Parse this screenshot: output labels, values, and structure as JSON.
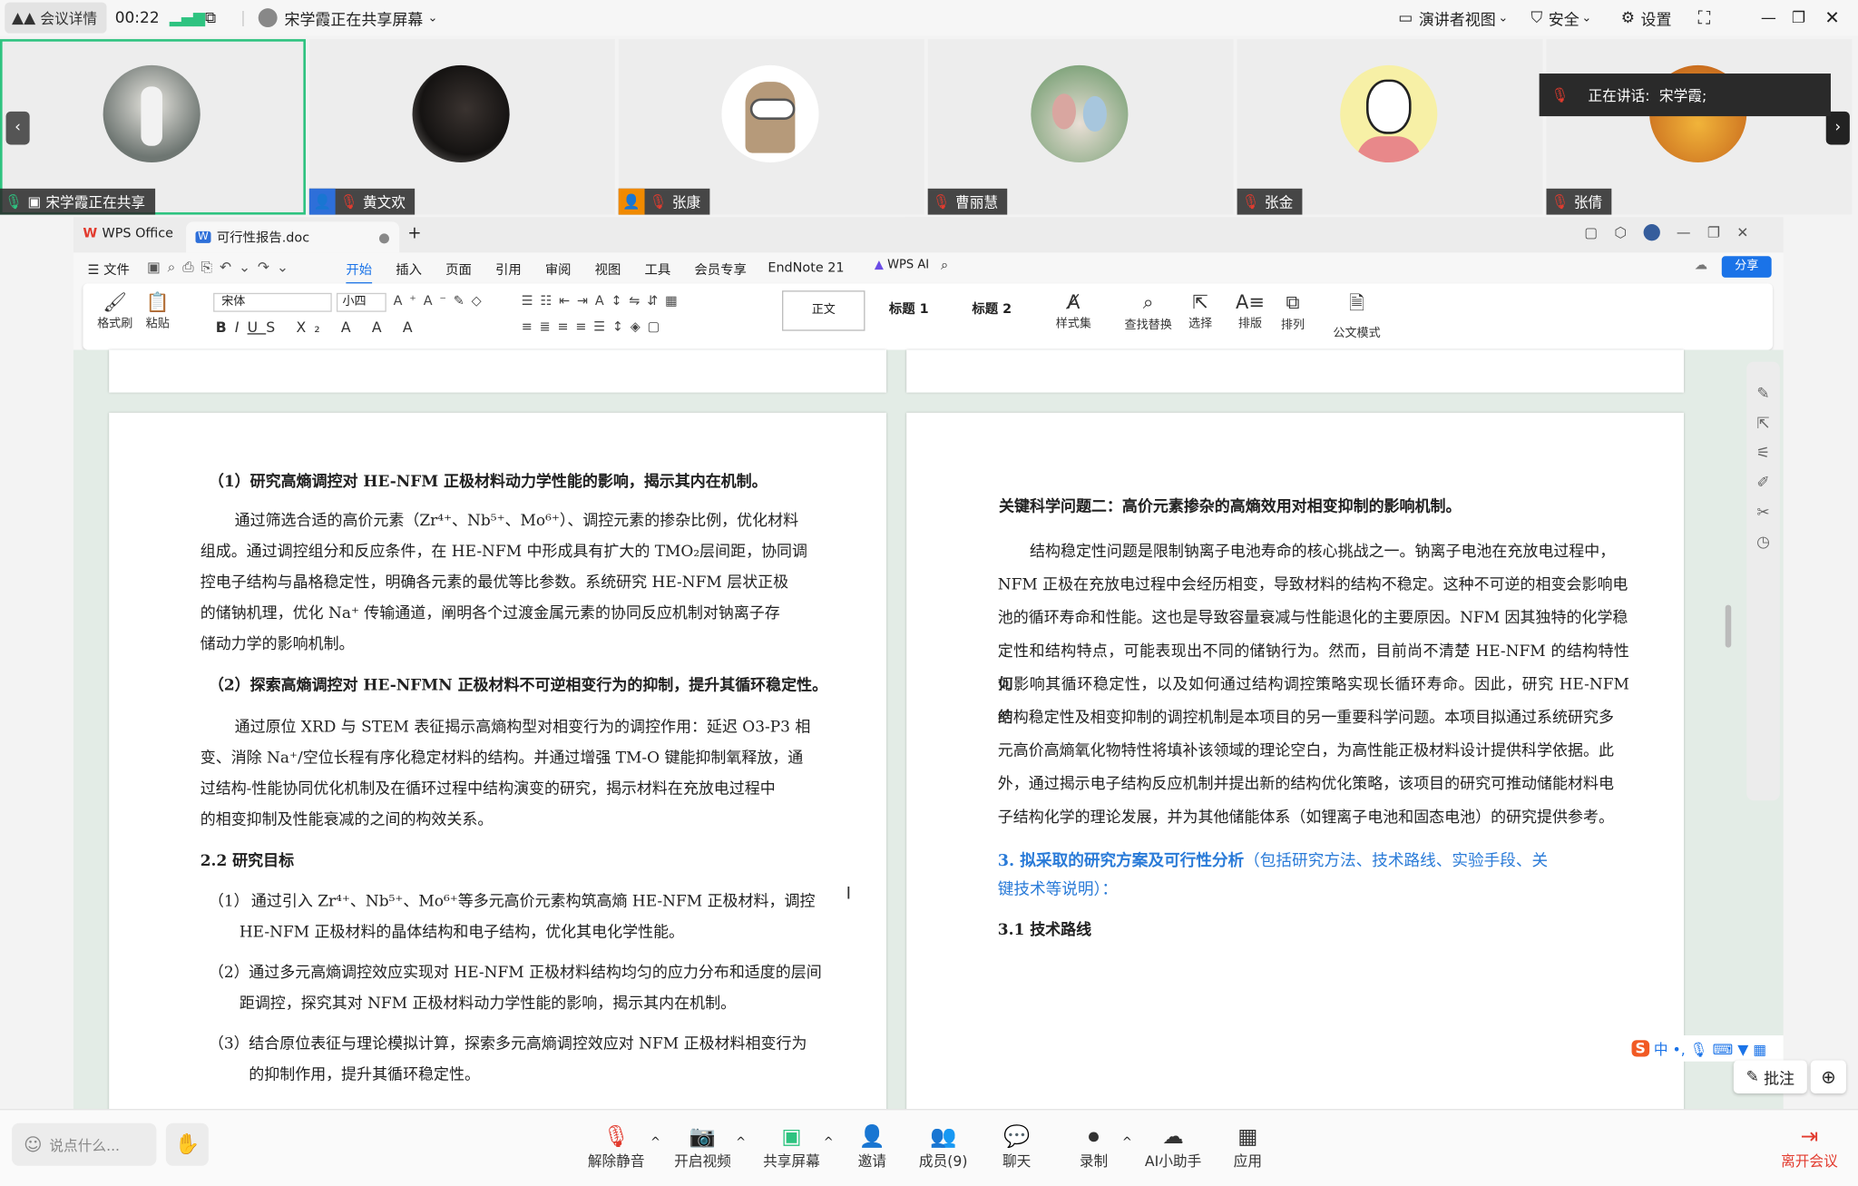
{
  "topbar": {
    "meeting_details": "会议详情",
    "timer": "00:22",
    "sharing_status": "宋学霞正在共享屏幕",
    "presenter_view": "演讲者视图",
    "security": "安全",
    "settings": "设置"
  },
  "speaking": {
    "label": "正在讲话:",
    "name": "宋学霞;"
  },
  "participants": [
    {
      "name": "宋学霞正在共享"
    },
    {
      "name": "黄文欢"
    },
    {
      "name": "张康"
    },
    {
      "name": "曹丽慧"
    },
    {
      "name": "张金"
    },
    {
      "name": "张倩"
    }
  ],
  "wps": {
    "app_tab": "WPS Office",
    "doc_tab": "可行性报告.doc",
    "menu": [
      "文件",
      "开始",
      "插入",
      "页面",
      "引用",
      "审阅",
      "视图",
      "工具",
      "会员专享",
      "EndNote 21"
    ],
    "wps_ai": "WPS AI",
    "share": "分享",
    "font_name": "宋体",
    "font_size": "小四",
    "styles": [
      "正文",
      "标题 1",
      "标题 2"
    ],
    "ribbon_labels": {
      "format_painter": "格式刷",
      "paste": "粘贴",
      "style_set": "样式集",
      "find_replace": "查找替换",
      "select": "选择",
      "layout": "排版",
      "arrange": "排列",
      "doc_mode": "公文模式"
    }
  },
  "left_page": {
    "h1": "（1）研究高熵调控对 HE-NFM 正极材料动力学性能的影响，揭示其内在机制。",
    "p1": [
      "通过筛选合适的高价元素（Zr⁴⁺、Nb⁵⁺、Mo⁶⁺）、调控元素的掺杂比例，优化材料",
      "组成。通过调控组分和反应条件，在 HE-NFM 中形成具有扩大的 TMO₂层间距，协同调",
      "控电子结构与晶格稳定性，明确各元素的最优等比参数。系统研究 HE-NFM 层状正极",
      "的储钠机理，优化 Na⁺ 传输通道，阐明各个过渡金属元素的协同反应机制对钠离子存",
      "储动力学的影响机制。"
    ],
    "h2": "（2）探索高熵调控对 HE-NFMN 正极材料不可逆相变行为的抑制，提升其循环稳定性。",
    "p2": [
      "通过原位 XRD 与 STEM 表征揭示高熵构型对相变行为的调控作用：延迟 O3-P3 相",
      "变、消除 Na⁺/空位长程有序化稳定材料的结构。并通过增强 TM-O 键能抑制氧释放，通",
      "过结构-性能协同优化机制及在循环过程中结构演变的研究，揭示材料在充放电过程中",
      "的相变抑制及性能衰减的之间的构效关系。"
    ],
    "section": "2.2  研究目标",
    "items": [
      {
        "num": "（1）",
        "lines": [
          "通过引入 Zr⁴⁺、Nb⁵⁺、Mo⁶⁺等多元高价元素构筑高熵 HE-NFM 正极材料，调控",
          "HE-NFM 正极材料的晶体结构和电子结构，优化其电化学性能。"
        ]
      },
      {
        "num": "（2）",
        "lines": [
          "通过多元高熵调控效应实现对 HE-NFM 正极材料结构均匀的应力分布和适度的层间",
          "距调控，探究其对 NFM 正极材料动力学性能的影响，揭示其内在机制。"
        ]
      },
      {
        "num": "（3）",
        "lines": [
          "结合原位表征与理论模拟计算，探索多元高熵调控效应对 NFM 正极材料相变行为",
          "的抑制作用，提升其循环稳定性。"
        ]
      }
    ]
  },
  "right_page": {
    "h1": "关键科学问题二：高价元素掺杂的高熵效用对相变抑制的影响机制。",
    "p1": [
      "结构稳定性问题是限制钠离子电池寿命的核心挑战之一。钠离子电池在充放电过程中，",
      "NFM 正极在充放电过程中会经历相变，导致材料的结构不稳定。这种不可逆的相变会影响电",
      "池的循环寿命和性能。这也是导致容量衰减与性能退化的主要原因。NFM 因其独特的化学稳",
      "定性和结构特点，可能表现出不同的储钠行为。然而，目前尚不清楚 HE-NFM 的结构特性如",
      "何影响其循环稳定性，以及如何通过结构调控策略实现长循环寿命。因此，研究 HE-NFM 的",
      "结构稳定性及相变抑制的调控机制是本项目的另一重要科学问题。本项目拟通过系统研究多",
      "元高价高熵氧化物特性将填补该领域的理论空白，为高性能正极材料设计提供科学依据。此",
      "外，通过揭示电子结构反应机制并提出新的结构优化策略，该项目的研究可推动储能材料电",
      "子结构化学的理论发展，并为其他储能体系（如锂离子电池和固态电池）的研究提供参考。"
    ],
    "h2_bold": "3.  拟采取的研究方案及可行性分析",
    "h2_rest_1": "（包括研究方法、技术路线、实验手段、关",
    "h2_rest_2": "键技术等说明）：",
    "section": "3.1 技术路线"
  },
  "side_tools": {
    "annotate": "批注"
  },
  "bottombar": {
    "chat_placeholder": "说点什么...",
    "buttons": [
      "解除静音",
      "开启视频",
      "共享屏幕",
      "邀请",
      "成员(9)",
      "聊天",
      "录制",
      "AI小助手",
      "应用"
    ],
    "leave": "离开会议"
  },
  "colors": {
    "accent_green": "#2ec380",
    "leave_red": "#e23b2e",
    "share_blue": "#1a73e8"
  }
}
